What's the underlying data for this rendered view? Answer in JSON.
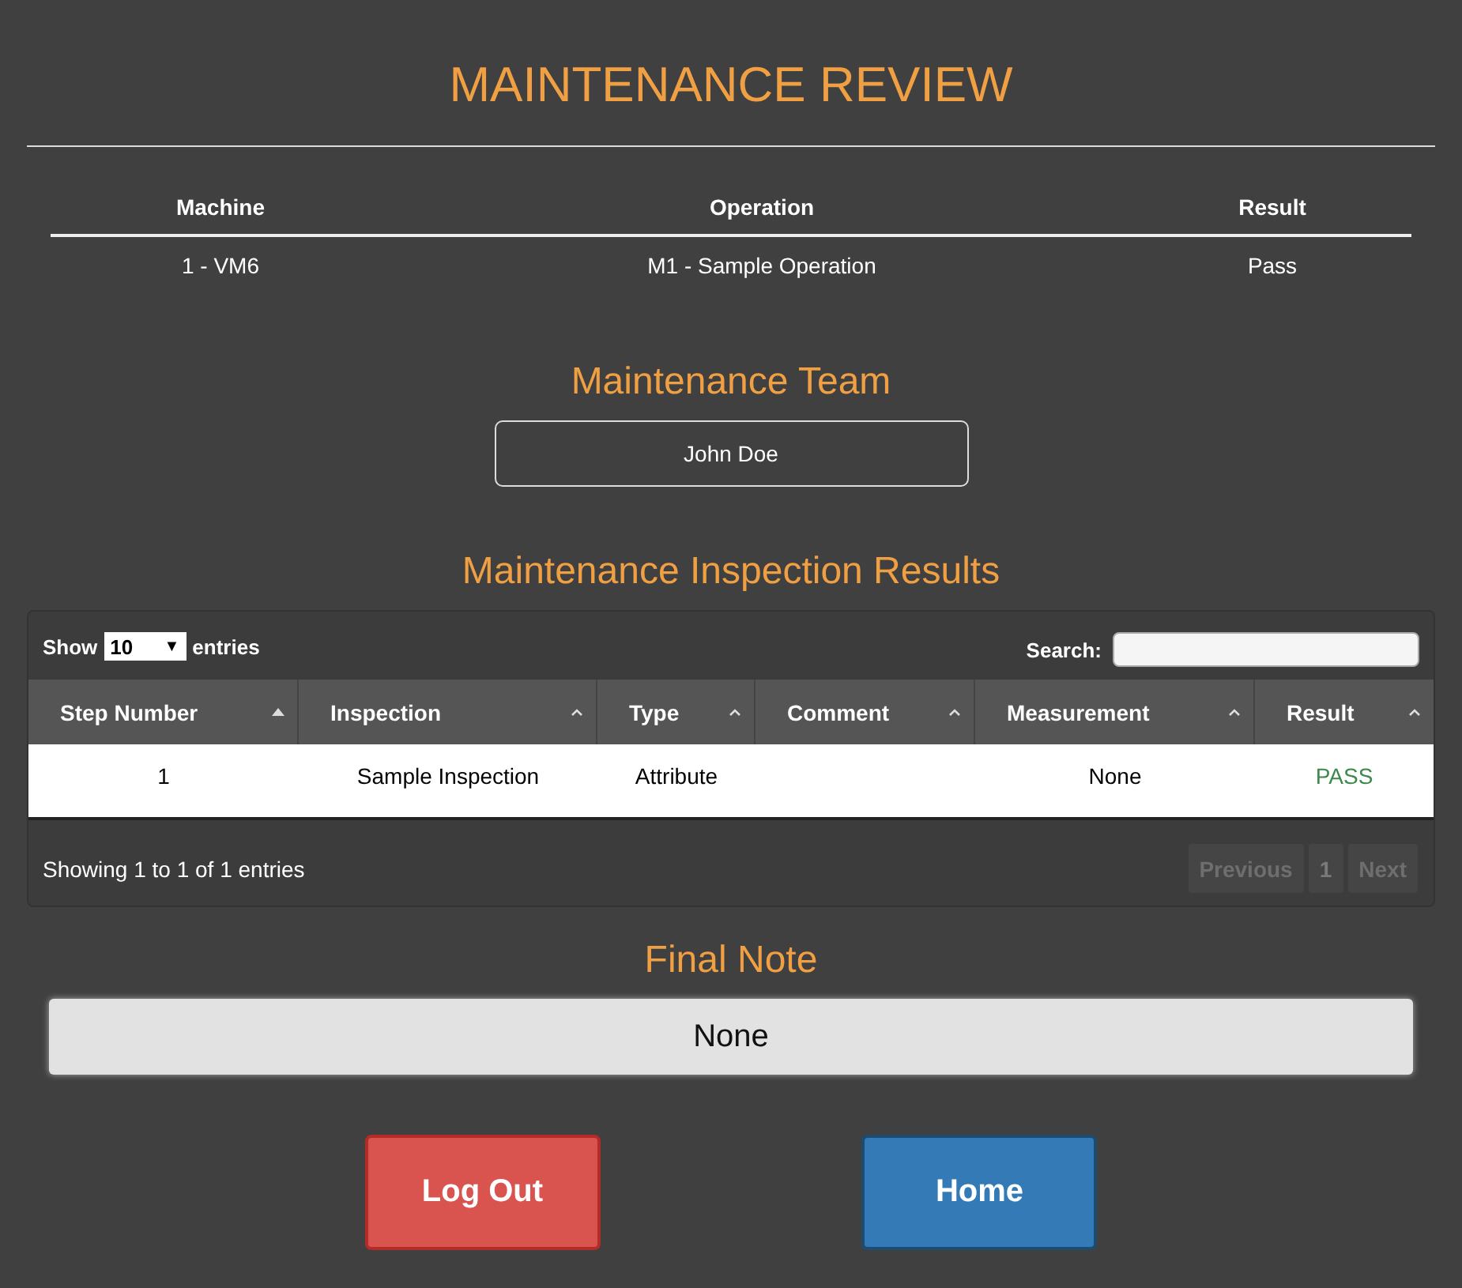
{
  "title": "MAINTENANCE REVIEW",
  "summary": {
    "columns": [
      "Machine",
      "Operation",
      "Result"
    ],
    "rows": [
      [
        "1 - VM6",
        "M1 - Sample Operation",
        "Pass"
      ]
    ]
  },
  "team": {
    "heading": "Maintenance Team",
    "members": [
      "John Doe"
    ]
  },
  "inspection": {
    "heading": "Maintenance Inspection Results",
    "length_label_before": "Show",
    "length_value": "10",
    "length_caret": "▼",
    "length_label_after": "entries",
    "search_label": "Search:",
    "columns": [
      {
        "label": "Step Number",
        "sorted": true
      },
      {
        "label": "Inspection",
        "sorted": false
      },
      {
        "label": "Type",
        "sorted": false
      },
      {
        "label": "Comment",
        "sorted": false
      },
      {
        "label": "Measurement",
        "sorted": false
      },
      {
        "label": "Result",
        "sorted": false
      }
    ],
    "rows": [
      {
        "cells": [
          "1",
          "Sample Inspection",
          "Attribute",
          "",
          "None",
          "PASS"
        ]
      }
    ],
    "info": "Showing 1 to 1 of 1 entries",
    "pages": [
      {
        "label": "Previous",
        "disabled": true
      },
      {
        "label": "1",
        "disabled": false
      },
      {
        "label": "Next",
        "disabled": true
      }
    ]
  },
  "final_note": {
    "heading": "Final Note",
    "value": "None"
  },
  "buttons": [
    {
      "label": "Log Out",
      "kind": "danger"
    },
    {
      "label": "Home",
      "kind": "primary"
    }
  ]
}
